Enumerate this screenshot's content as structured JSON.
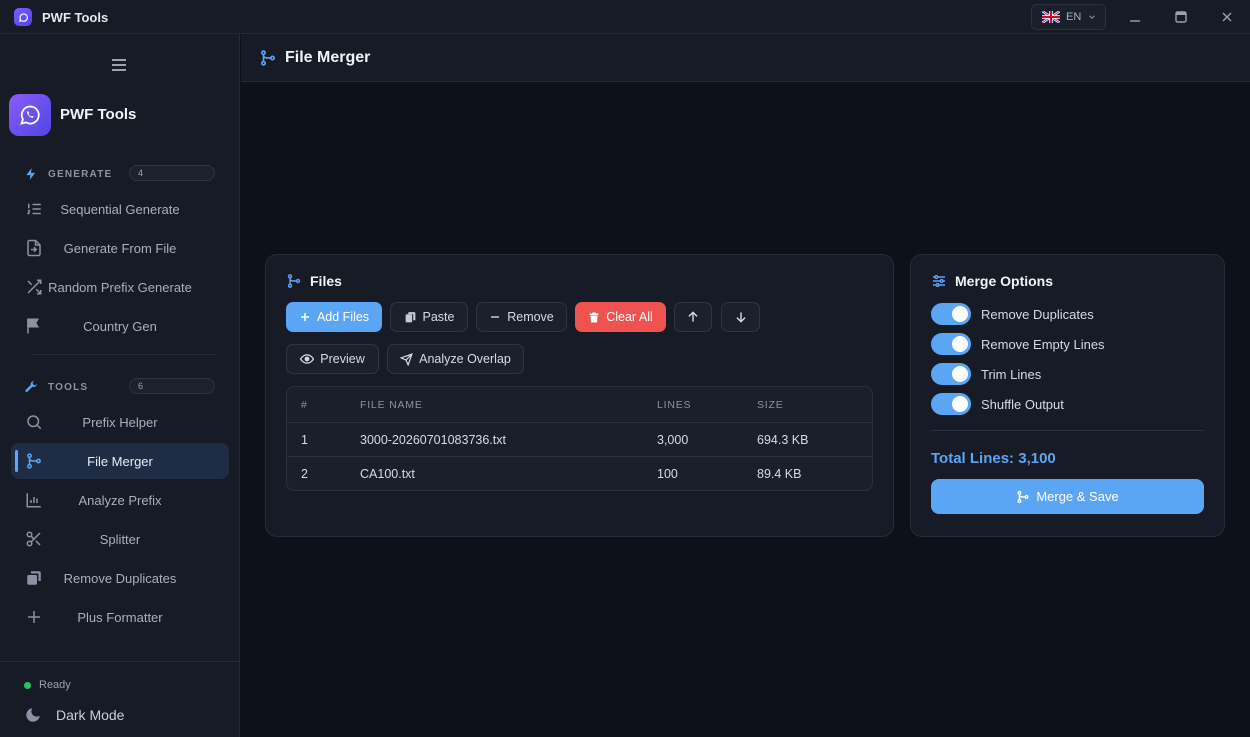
{
  "titlebar": {
    "title": "PWF Tools",
    "language": "EN"
  },
  "sidebar": {
    "brand": "PWF Tools",
    "sections": [
      {
        "label": "GENERATE",
        "count": "4"
      },
      {
        "label": "TOOLS",
        "count": "6"
      }
    ],
    "generate_items": [
      {
        "label": "Sequential Generate",
        "icon": "list-ordered-icon"
      },
      {
        "label": "Generate From File",
        "icon": "file-import-icon"
      },
      {
        "label": "Random Prefix Generate",
        "icon": "shuffle-icon"
      },
      {
        "label": "Country Gen",
        "icon": "flag-icon"
      }
    ],
    "tool_items": [
      {
        "label": "Prefix Helper",
        "icon": "search-icon"
      },
      {
        "label": "File Merger",
        "icon": "merge-icon",
        "active": true
      },
      {
        "label": "Analyze Prefix",
        "icon": "bar-chart-icon"
      },
      {
        "label": "Splitter",
        "icon": "scissors-icon"
      },
      {
        "label": "Remove Duplicates",
        "icon": "copy-icon"
      },
      {
        "label": "Plus Formatter",
        "icon": "plus-icon"
      }
    ],
    "status": "Ready",
    "dark_mode_label": "Dark Mode"
  },
  "header": {
    "title": "File Merger"
  },
  "files_card": {
    "title": "Files",
    "buttons": {
      "add": "Add Files",
      "paste": "Paste",
      "remove": "Remove",
      "clear": "Clear All",
      "preview": "Preview",
      "analyze": "Analyze Overlap"
    },
    "columns": [
      "#",
      "FILE NAME",
      "LINES",
      "SIZE"
    ],
    "rows": [
      {
        "index": "1",
        "name": "3000-20260701083736.txt",
        "lines": "3,000",
        "size": "694.3 KB"
      },
      {
        "index": "2",
        "name": "CA100.txt",
        "lines": "100",
        "size": "89.4 KB"
      }
    ]
  },
  "options_card": {
    "title": "Merge Options",
    "options": [
      {
        "label": "Remove Duplicates",
        "enabled": true
      },
      {
        "label": "Remove Empty Lines",
        "enabled": true
      },
      {
        "label": "Trim Lines",
        "enabled": true
      },
      {
        "label": "Shuffle Output",
        "enabled": true
      }
    ],
    "total": "Total Lines: 3,100",
    "merge_button": "Merge & Save"
  },
  "colors": {
    "accent": "#5ba5f5",
    "danger": "#ef5350",
    "sidebar_bg": "#161b25",
    "page_bg": "#0d111a"
  }
}
